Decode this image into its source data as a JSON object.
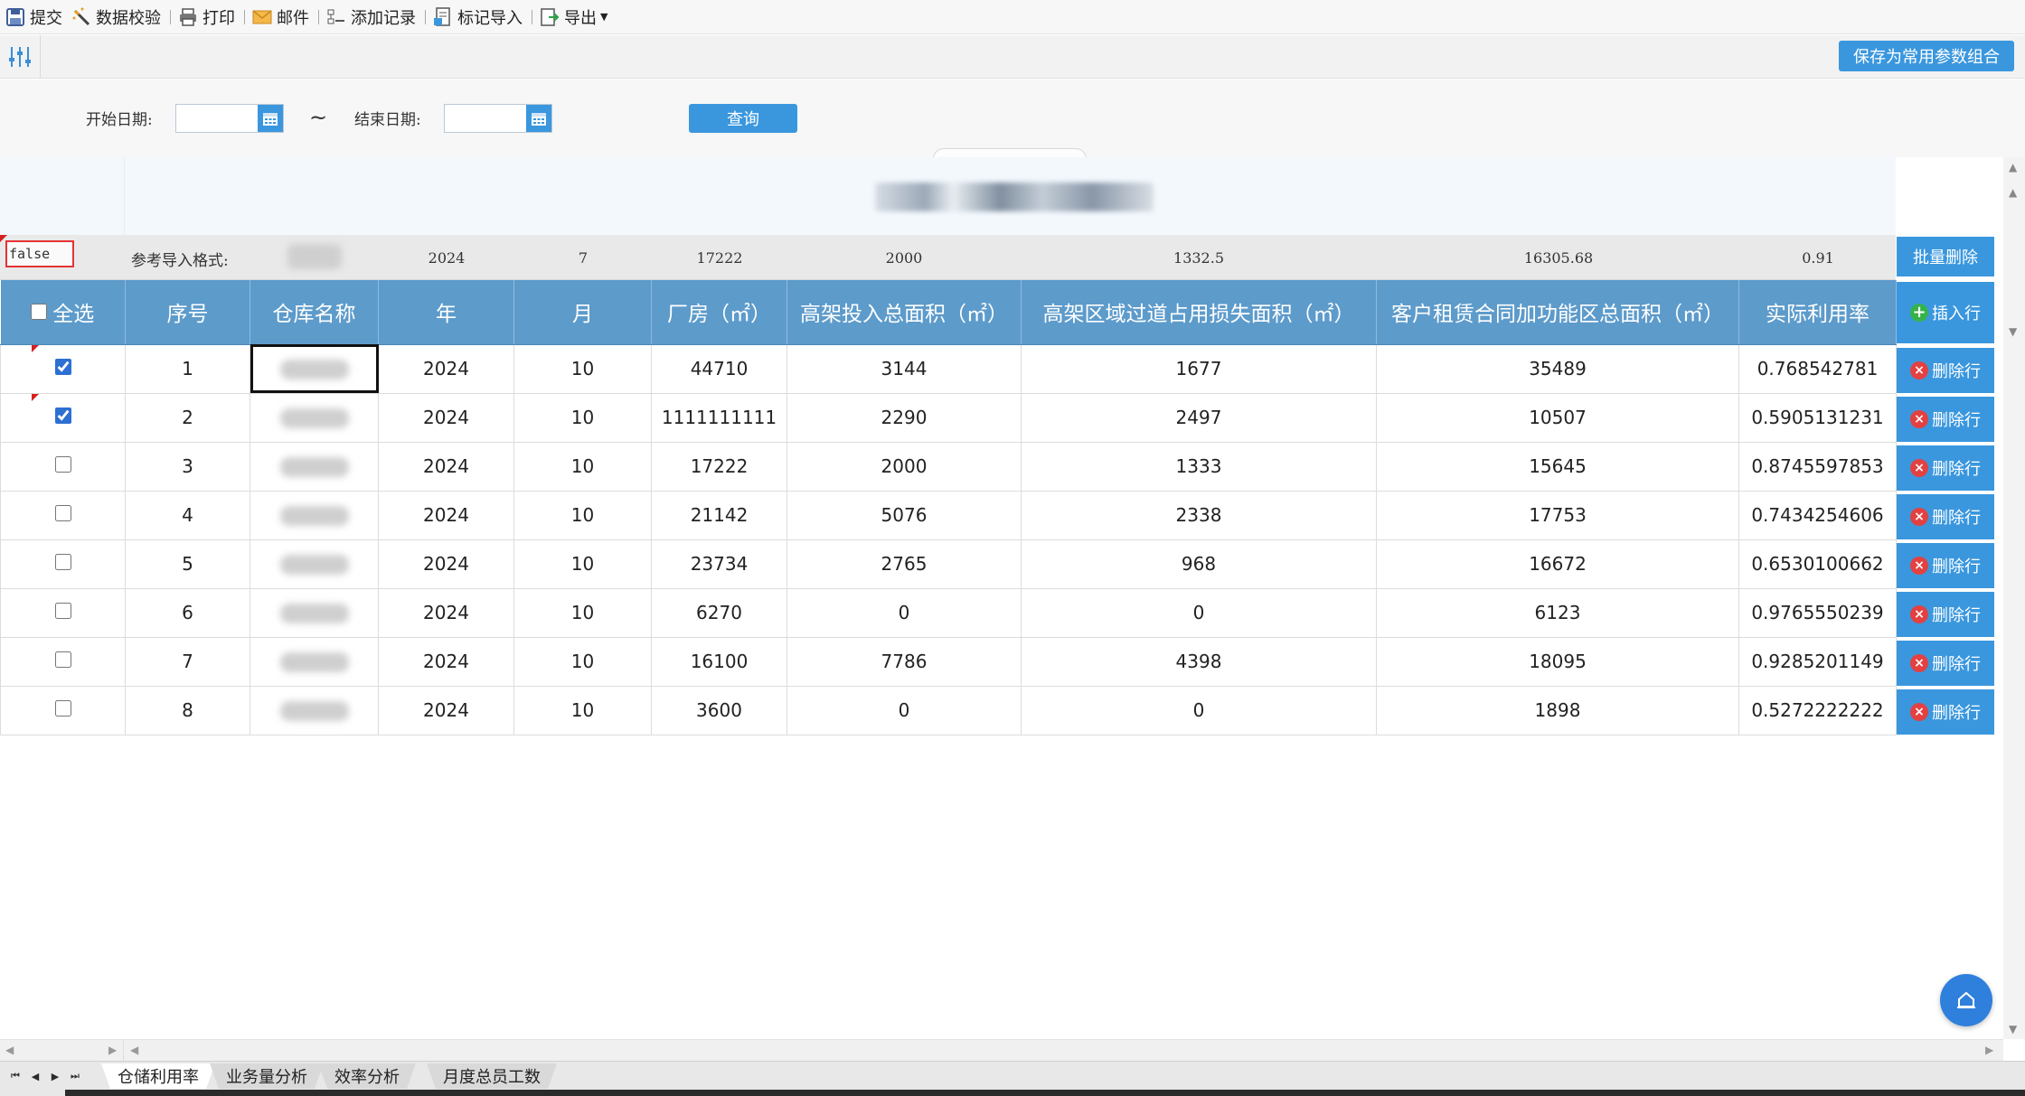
{
  "toolbar": {
    "submit": "提交",
    "validate": "数据校验",
    "print": "打印",
    "mail": "邮件",
    "add_record": "添加记录",
    "mark_import": "标记导入",
    "export": "导出"
  },
  "params": {
    "save_combo": "保存为常用参数组合",
    "start_label": "开始日期:",
    "end_label": "结束日期:",
    "tilde": "~",
    "query": "查询"
  },
  "ref_row": {
    "flag": "false",
    "label": "参考导入格式:",
    "year": "2024",
    "month": "7",
    "factory": "17222",
    "highrack": "2000",
    "aisle_loss": "1332.5",
    "lease": "16305.68",
    "rate": "0.91"
  },
  "buttons": {
    "batch_delete": "批量删除",
    "insert_row": "插入行",
    "delete_row": "删除行"
  },
  "table": {
    "select_all": "全选",
    "headers": [
      "序号",
      "仓库名称",
      "年",
      "月",
      "厂房（㎡）",
      "高架投入总面积（㎡）",
      "高架区域过道占用损失面积（㎡）",
      "客户租赁合同加功能区总面积（㎡）",
      "实际利用率"
    ],
    "rows": [
      {
        "checked": true,
        "seq": "1",
        "name": "",
        "year": "2024",
        "month": "10",
        "factory": "44710",
        "highrack": "3144",
        "aisle": "1677",
        "lease": "35489",
        "rate": "0.768542781"
      },
      {
        "checked": true,
        "seq": "2",
        "name": "",
        "year": "2024",
        "month": "10",
        "factory": "1111111111",
        "highrack": "2290",
        "aisle": "2497",
        "lease": "10507",
        "rate": "0.5905131231"
      },
      {
        "checked": false,
        "seq": "3",
        "name": "",
        "year": "2024",
        "month": "10",
        "factory": "17222",
        "highrack": "2000",
        "aisle": "1333",
        "lease": "15645",
        "rate": "0.8745597853"
      },
      {
        "checked": false,
        "seq": "4",
        "name": "",
        "year": "2024",
        "month": "10",
        "factory": "21142",
        "highrack": "5076",
        "aisle": "2338",
        "lease": "17753",
        "rate": "0.7434254606"
      },
      {
        "checked": false,
        "seq": "5",
        "name": "",
        "year": "2024",
        "month": "10",
        "factory": "23734",
        "highrack": "2765",
        "aisle": "968",
        "lease": "16672",
        "rate": "0.6530100662"
      },
      {
        "checked": false,
        "seq": "6",
        "name": "",
        "year": "2024",
        "month": "10",
        "factory": "6270",
        "highrack": "0",
        "aisle": "0",
        "lease": "6123",
        "rate": "0.9765550239"
      },
      {
        "checked": false,
        "seq": "7",
        "name": "",
        "year": "2024",
        "month": "10",
        "factory": "16100",
        "highrack": "7786",
        "aisle": "4398",
        "lease": "18095",
        "rate": "0.9285201149"
      },
      {
        "checked": false,
        "seq": "8",
        "name": "",
        "year": "2024",
        "month": "10",
        "factory": "3600",
        "highrack": "0",
        "aisle": "0",
        "lease": "1898",
        "rate": "0.5272222222"
      }
    ]
  },
  "sheet_tabs": [
    "仓储利用率",
    "业务量分析",
    "效率分析",
    "月度总员工数"
  ],
  "colors": {
    "accent": "#3a97de",
    "header": "#5d9bcb",
    "danger": "#e34141",
    "success": "#35b24a"
  }
}
